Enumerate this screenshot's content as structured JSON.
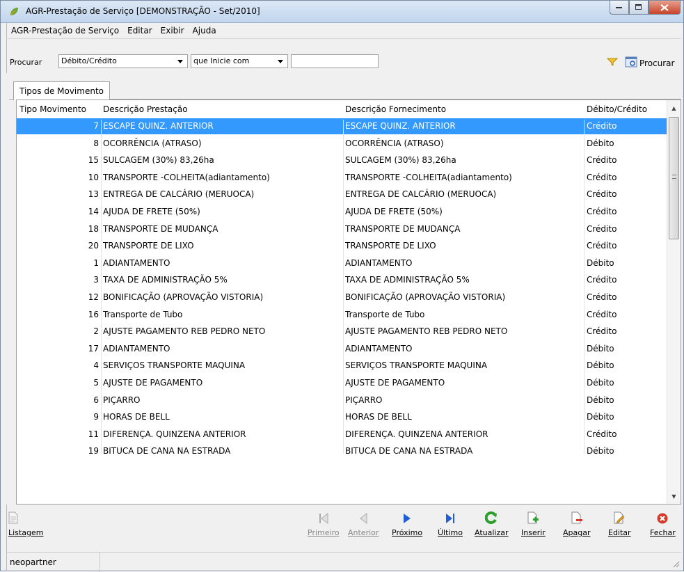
{
  "window": {
    "title": "AGR-Prestação de Serviço [DEMONSTRAÇÃO - Set/2010]",
    "menu": [
      "AGR-Prestação de Serviço",
      "Editar",
      "Exibir",
      "Ajuda"
    ]
  },
  "toolbar": {
    "search_label": "Procurar",
    "field_select": "Débito/Crédito",
    "mode_select": "que Inicie com",
    "search_value": "",
    "search_button": "Procurar"
  },
  "tab": "Tipos de Movimento",
  "grid": {
    "columns": [
      "Tipo Movimento",
      "Descrição Prestação",
      "Descrição Fornecimento",
      "Débito/Crédito"
    ],
    "rows": [
      [
        "7",
        "ESCAPE QUINZ. ANTERIOR",
        "ESCAPE QUINZ. ANTERIOR",
        "Crédito"
      ],
      [
        "8",
        "OCORRÊNCIA (ATRASO)",
        "OCORRÊNCIA (ATRASO)",
        "Débito"
      ],
      [
        "15",
        "SULCAGEM (30%) 83,26ha",
        "SULCAGEM (30%) 83,26ha",
        "Crédito"
      ],
      [
        "10",
        "TRANSPORTE -COLHEITA(adiantamento)",
        "TRANSPORTE -COLHEITA(adiantamento)",
        "Crédito"
      ],
      [
        "13",
        "ENTREGA DE CALCÁRIO (MERUOCA)",
        "ENTREGA DE CALCÁRIO (MERUOCA)",
        "Crédito"
      ],
      [
        "14",
        "AJUDA DE FRETE (50%)",
        "AJUDA DE FRETE (50%)",
        "Crédito"
      ],
      [
        "18",
        "TRANSPORTE DE MUDANÇA",
        "TRANSPORTE DE MUDANÇA",
        "Crédito"
      ],
      [
        "20",
        "TRANSPORTE DE LIXO",
        "TRANSPORTE DE LIXO",
        "Crédito"
      ],
      [
        "1",
        "ADIANTAMENTO",
        "ADIANTAMENTO",
        "Débito"
      ],
      [
        "3",
        "TAXA  DE ADMINISTRAÇÃO 5%",
        "TAXA  DE ADMINISTRAÇÃO 5%",
        "Crédito"
      ],
      [
        "12",
        "BONIFICAÇÃO (APROVAÇÃO VISTORIA)",
        "BONIFICAÇÃO (APROVAÇÃO VISTORIA)",
        "Crédito"
      ],
      [
        "16",
        "Transporte de Tubo",
        "Transporte de Tubo",
        "Crédito"
      ],
      [
        "2",
        "AJUSTE PAGAMENTO REB PEDRO NETO",
        "AJUSTE PAGAMENTO REB PEDRO NETO",
        "Crédito"
      ],
      [
        "17",
        "ADIANTAMENTO",
        "ADIANTAMENTO",
        "Débito"
      ],
      [
        "4",
        "SERVIÇOS TRANSPORTE MAQUINA",
        "SERVIÇOS TRANSPORTE MAQUINA",
        "Débito"
      ],
      [
        "5",
        "AJUSTE DE PAGAMENTO",
        "AJUSTE DE PAGAMENTO",
        "Débito"
      ],
      [
        "6",
        "PIÇARRO",
        "PIÇARRO",
        "Débito"
      ],
      [
        "9",
        "HORAS DE BELL",
        "HORAS DE BELL",
        "Débito"
      ],
      [
        "11",
        "DIFERENÇA. QUINZENA ANTERIOR",
        "DIFERENÇA. QUINZENA ANTERIOR",
        "Crédito"
      ],
      [
        "19",
        "BITUCA DE CANA NA ESTRADA",
        "BITUCA DE CANA NA ESTRADA",
        "Débito"
      ]
    ],
    "selected_row": 0
  },
  "actions": {
    "listagem": "Listagem",
    "primeiro": "Primeiro",
    "anterior": "Anterior",
    "proximo": "Próximo",
    "ultimo": "Último",
    "atualizar": "Atualizar",
    "inserir": "Inserir",
    "apagar": "Apagar",
    "editar": "Editar",
    "fechar": "Fechar"
  },
  "status": {
    "user": "neopartner"
  },
  "colors": {
    "selection": "#3399ff",
    "nav_blue": "#1f5fd6",
    "refresh_green": "#2e9e2e",
    "close_red": "#d43b2b"
  }
}
